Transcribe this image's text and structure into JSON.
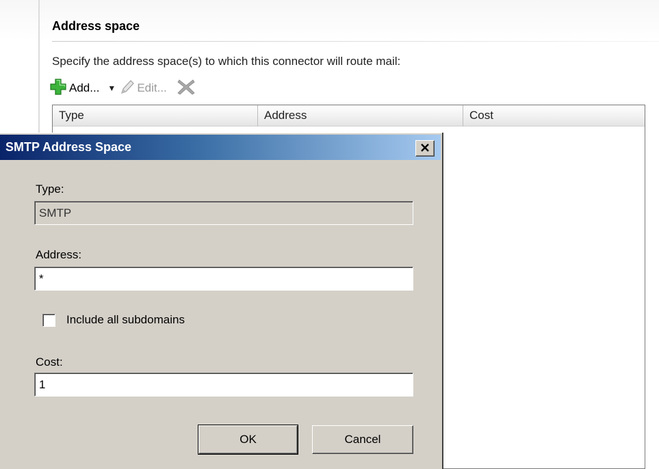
{
  "section": {
    "title": "Address space",
    "description": "Specify the address space(s) to which this connector will route mail:"
  },
  "toolbar": {
    "add_label": "Add...",
    "add_icon": "green-plus-icon",
    "dropdown_glyph": "▼",
    "edit_label": "Edit...",
    "edit_icon": "pencil-icon",
    "delete_icon": "red-x-icon"
  },
  "grid": {
    "columns": [
      "Type",
      "Address",
      "Cost"
    ],
    "rows": []
  },
  "dialog": {
    "title": "SMTP Address Space",
    "close_icon": "close-icon",
    "type_label": "Type:",
    "type_value": "SMTP",
    "address_label": "Address:",
    "address_value": "*",
    "include_subdomains_label": "Include all subdomains",
    "include_subdomains_checked": false,
    "cost_label": "Cost:",
    "cost_value": "1",
    "ok_label": "OK",
    "cancel_label": "Cancel"
  },
  "colors": {
    "titlebar_start": "#0a246a",
    "titlebar_end": "#a6caf0",
    "dialog_face": "#d4d0c8",
    "add_icon_green": "#3cb43c"
  }
}
